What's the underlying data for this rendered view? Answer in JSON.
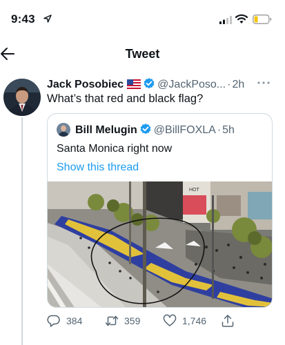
{
  "status_bar": {
    "time": "9:43"
  },
  "header": {
    "title": "Tweet"
  },
  "tweet": {
    "author_name": "Jack Posobiec",
    "author_handle": "@JackPoso...",
    "time": "2h",
    "text": "What’s that red and black flag?"
  },
  "quoted": {
    "author_name": "Bill Melugin",
    "author_handle": "@BillFOXLA",
    "time": "5h",
    "text": "Santa Monica right now",
    "show_thread": "Show this thread",
    "media_sign": "HOT"
  },
  "actions": {
    "replies": "384",
    "retweets": "359",
    "likes": "1,746"
  },
  "colors": {
    "accent": "#1d9bf0",
    "verified": "#1d9bf0",
    "secondary_text": "#536471",
    "border": "#cfd9de"
  }
}
